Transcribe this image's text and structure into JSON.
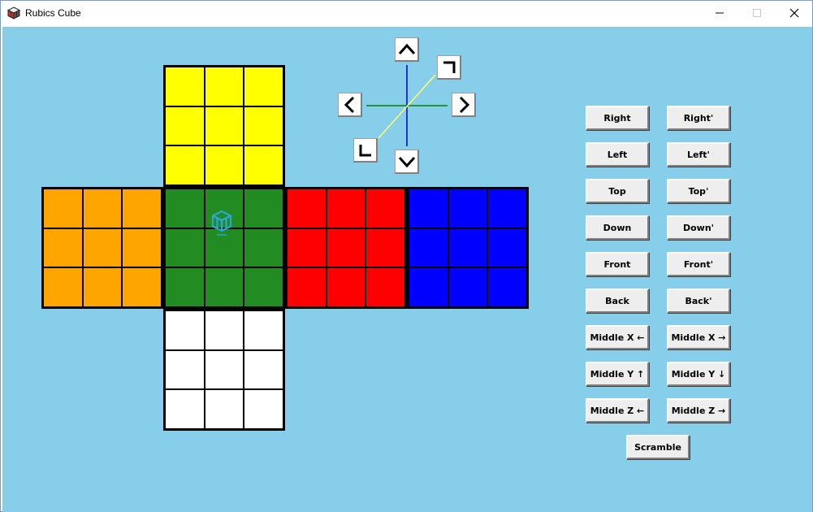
{
  "window": {
    "title": "Rubics Cube"
  },
  "cube": {
    "top": [
      "#ffff00",
      "#ffff00",
      "#ffff00",
      "#ffff00",
      "#ffff00",
      "#ffff00",
      "#ffff00",
      "#ffff00",
      "#ffff00"
    ],
    "left": [
      "#ffa500",
      "#ffa500",
      "#ffa500",
      "#ffa500",
      "#ffa500",
      "#ffa500",
      "#ffa500",
      "#ffa500",
      "#ffa500"
    ],
    "front": [
      "#228b22",
      "#228b22",
      "#228b22",
      "#228b22",
      "#228b22",
      "#228b22",
      "#228b22",
      "#228b22",
      "#228b22"
    ],
    "right": [
      "#ff0000",
      "#ff0000",
      "#ff0000",
      "#ff0000",
      "#ff0000",
      "#ff0000",
      "#ff0000",
      "#ff0000",
      "#ff0000"
    ],
    "back": [
      "#0000ff",
      "#0000ff",
      "#0000ff",
      "#0000ff",
      "#0000ff",
      "#0000ff",
      "#0000ff",
      "#0000ff",
      "#0000ff"
    ],
    "down": [
      "#ffffff",
      "#ffffff",
      "#ffffff",
      "#ffffff",
      "#ffffff",
      "#ffffff",
      "#ffffff",
      "#ffffff",
      "#ffffff"
    ]
  },
  "rotation": {
    "axis_colors": {
      "vertical": "#0000cc",
      "horizontal": "#008000",
      "diagonal": "#ffff66"
    },
    "icons": [
      "chevron-up-icon",
      "chevron-down-icon",
      "chevron-left-icon",
      "chevron-right-icon",
      "corner-top-right-icon",
      "corner-bottom-left-icon"
    ]
  },
  "controls": {
    "right": "Right",
    "right_prime": "Right'",
    "left": "Left",
    "left_prime": "Left'",
    "top": "Top",
    "top_prime": "Top'",
    "down": "Down",
    "down_prime": "Down'",
    "front": "Front",
    "front_prime": "Front'",
    "back": "Back",
    "back_prime": "Back'",
    "middle_x_left": "Middle X ←",
    "middle_x_right": "Middle X →",
    "middle_y_up": "Middle Y ↑",
    "middle_y_down": "Middle Y ↓",
    "middle_z_left": "Middle Z ←",
    "middle_z_right": "Middle Z →",
    "scramble": "Scramble"
  }
}
